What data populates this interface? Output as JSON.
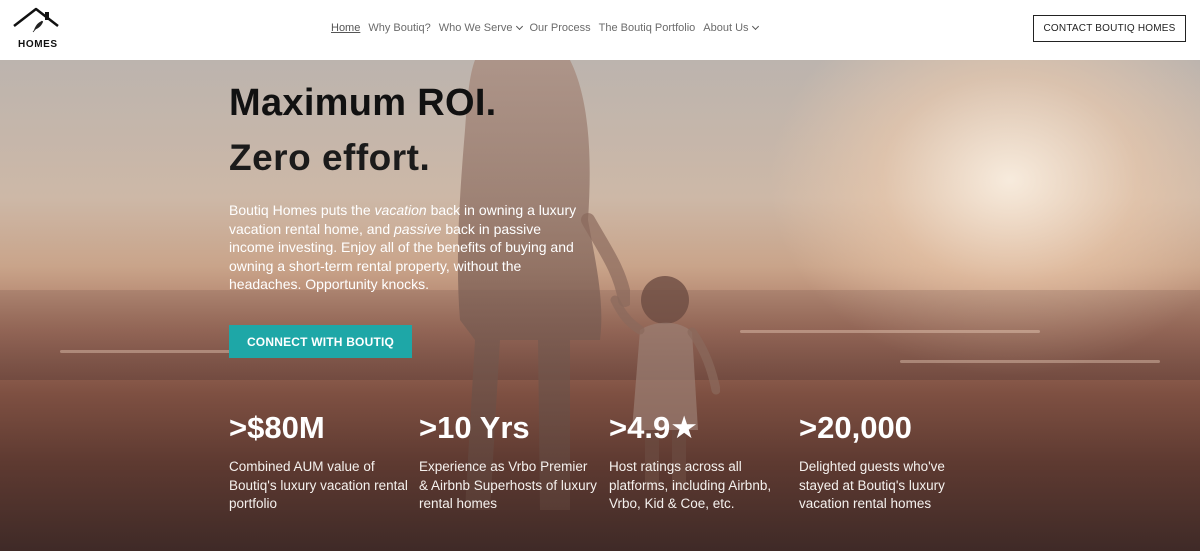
{
  "header": {
    "logo_text": "HOMES",
    "nav": [
      {
        "label": "Home",
        "active": true,
        "dropdown": false
      },
      {
        "label": "Why Boutiq?",
        "active": false,
        "dropdown": false
      },
      {
        "label": "Who We Serve",
        "active": false,
        "dropdown": true
      },
      {
        "label": "Our Process",
        "active": false,
        "dropdown": false
      },
      {
        "label": "The Boutiq Portfolio",
        "active": false,
        "dropdown": false
      },
      {
        "label": "About Us",
        "active": false,
        "dropdown": true
      }
    ],
    "contact_label": "CONTACT BOUTIQ HOMES"
  },
  "hero": {
    "headline": "Maximum ROI.",
    "subhead": "Zero effort.",
    "intro_parts": [
      "Boutiq Homes puts the ",
      "vacation",
      " back in owning a luxury vacation rental home, and ",
      "passive",
      " back in passive income investing. Enjoy all of the benefits of buying and owning a short-term rental property, without the headaches. Opportunity knocks."
    ],
    "cta_label": "CONNECT WITH BOUTIQ",
    "stats": [
      {
        "value": ">$80M",
        "desc": "Combined AUM value of Boutiq's luxury vacation rental portfolio"
      },
      {
        "value": ">10 Yrs",
        "desc": "Experience as Vrbo Premier & Airbnb Superhosts of luxury rental homes"
      },
      {
        "value": ">4.9★",
        "desc": "Host ratings across all platforms, including Airbnb, Vrbo, Kid & Coe, etc."
      },
      {
        "value": ">20,000",
        "desc": "Delighted guests who've stayed at Boutiq's luxury vacation rental homes"
      }
    ]
  },
  "colors": {
    "accent": "#1ea7a7",
    "header_bg": "#ffffff",
    "headline": "#111111"
  },
  "icons": {
    "logo": "house-roof-logo-icon",
    "dropdown": "chevron-down-icon"
  }
}
